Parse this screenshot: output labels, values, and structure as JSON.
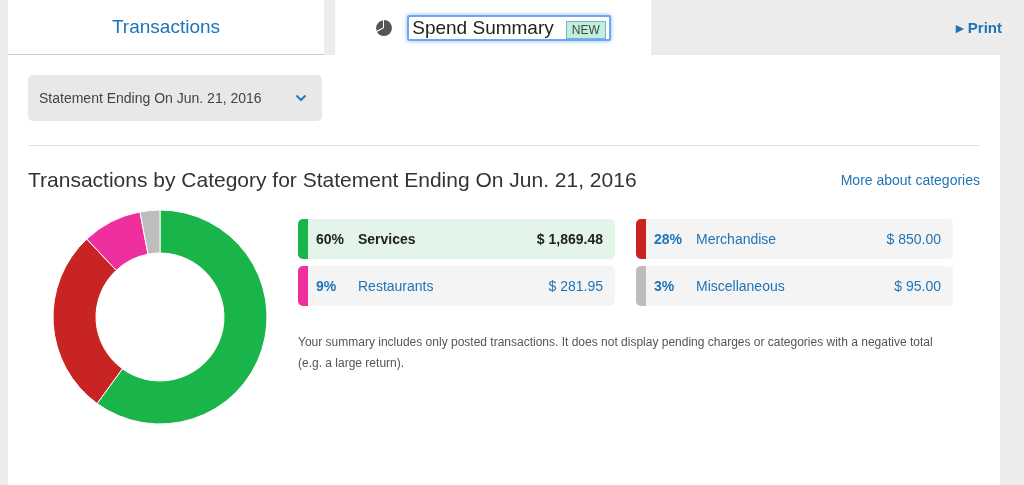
{
  "tabs": [
    {
      "label": "Transactions",
      "selected": false,
      "icon": false
    },
    {
      "label": "Spend Summary",
      "selected": true,
      "icon": true,
      "badge": "NEW"
    }
  ],
  "print_link": {
    "icon": "▸",
    "label": "Print"
  },
  "statement_select": {
    "value": "Statement Ending On Jun. 21, 2016"
  },
  "heading": "Transactions by Category for Statement Ending On Jun. 21, 2016",
  "more_link": "More about categories",
  "categories": [
    {
      "percent": "60%",
      "name": "Services",
      "amount": "$ 1,869.48",
      "color": "#1ab54a",
      "selected": true
    },
    {
      "percent": "28%",
      "name": "Merchandise",
      "amount": "$ 850.00",
      "color": "#c92424",
      "selected": false
    },
    {
      "percent": "9%",
      "name": "Restaurants",
      "amount": "$ 281.95",
      "color": "#ef2f9e",
      "selected": false
    },
    {
      "percent": "3%",
      "name": "Miscellaneous",
      "amount": "$ 95.00",
      "color": "#bdbdbd",
      "selected": false
    }
  ],
  "note": "Your summary includes only posted transactions. It does not display pending charges or categories with a negative total (e.g. a large return)."
}
